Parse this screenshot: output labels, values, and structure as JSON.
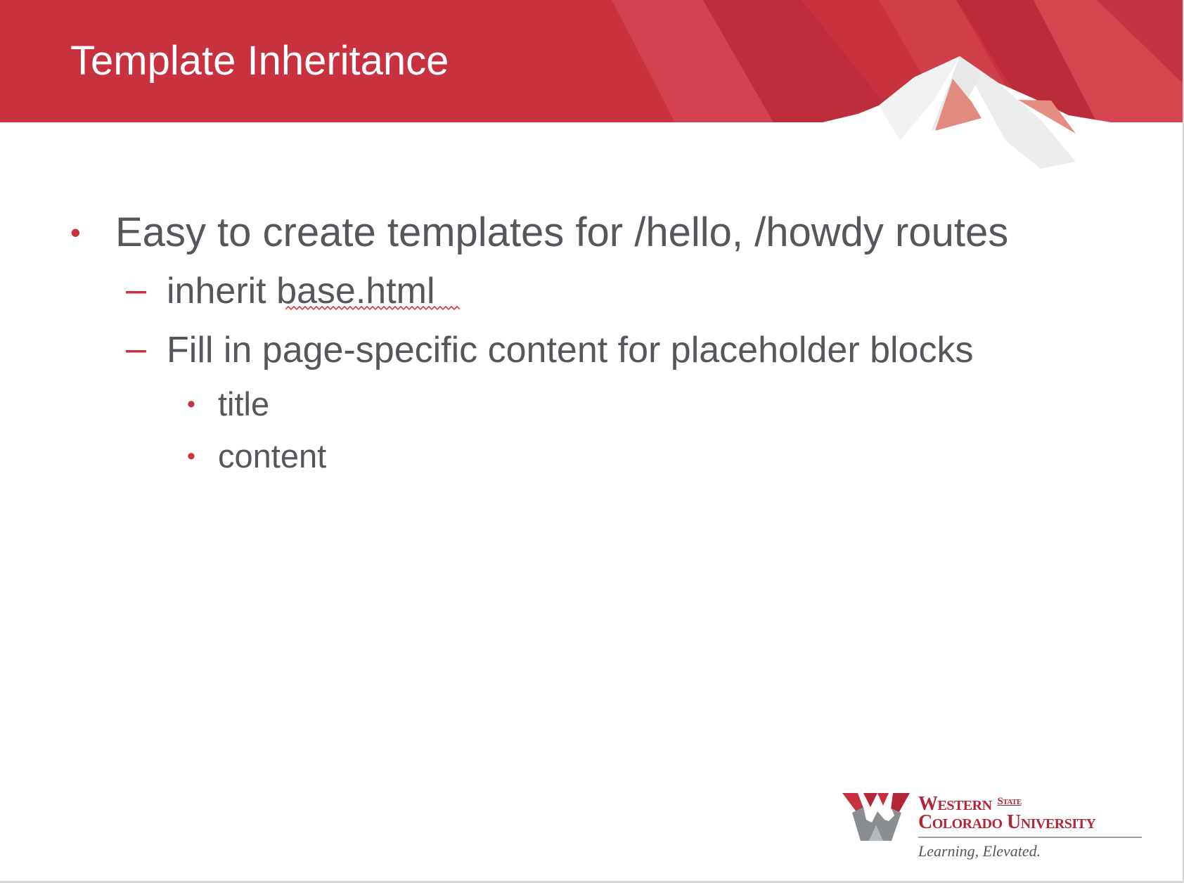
{
  "slide": {
    "title": "Template Inheritance",
    "bullets": [
      {
        "level": 1,
        "text": "Easy to create templates for /hello, /howdy routes",
        "children": [
          {
            "level": 2,
            "prefix": "inherit ",
            "text": "base.html",
            "spellcheck_flag": true
          },
          {
            "level": 2,
            "text": "Fill in page-specific content for placeholder blocks",
            "children": [
              {
                "level": 3,
                "text": "title"
              },
              {
                "level": 3,
                "text": "content"
              }
            ]
          }
        ]
      }
    ]
  },
  "markers": {
    "level1": "•",
    "level2": "–",
    "level3": "•"
  },
  "logo": {
    "line1": "Western",
    "line1_small": "State",
    "line2": "Colorado University",
    "tagline": "Learning, Elevated."
  },
  "colors": {
    "header_red": "#c8323f",
    "accent_red": "#c8323f",
    "body_text": "#54575b",
    "title_text": "#ffffff"
  }
}
